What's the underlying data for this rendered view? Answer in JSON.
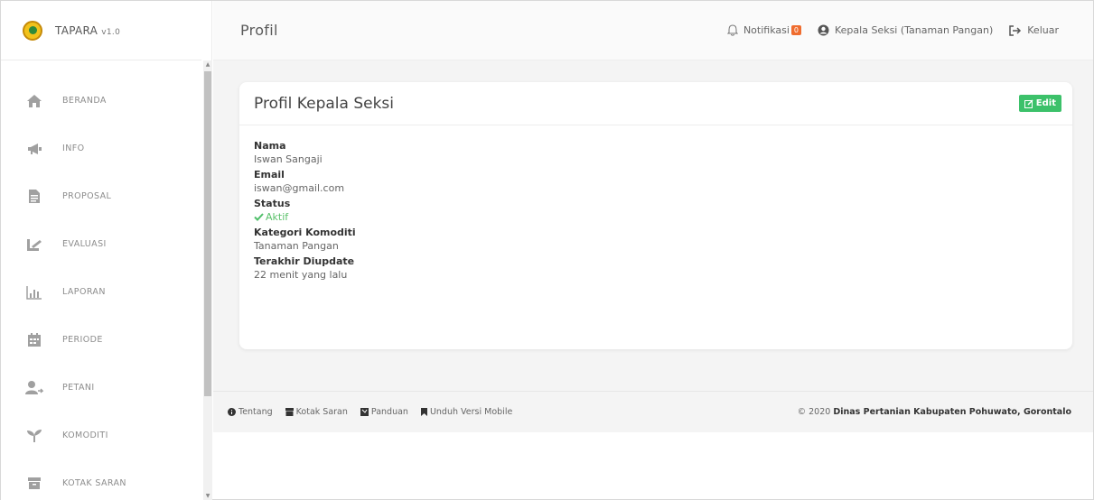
{
  "brand": {
    "name": "TAPARA",
    "version": "v1.0"
  },
  "sidebar": {
    "items": [
      {
        "label": "BERANDA",
        "icon": "home-icon"
      },
      {
        "label": "INFO",
        "icon": "megaphone-icon"
      },
      {
        "label": "PROPOSAL",
        "icon": "file-icon"
      },
      {
        "label": "EVALUASI",
        "icon": "evaluation-icon"
      },
      {
        "label": "LAPORAN",
        "icon": "bar-chart-icon"
      },
      {
        "label": "PERIODE",
        "icon": "calendar-icon"
      },
      {
        "label": "PETANI",
        "icon": "users-icon"
      },
      {
        "label": "KOMODITI",
        "icon": "sprout-icon"
      },
      {
        "label": "KOTAK SARAN",
        "icon": "inbox-icon"
      }
    ]
  },
  "header": {
    "title": "Profil",
    "notif_label": "Notifikasi",
    "notif_count": "0",
    "user_label": "Kepala Seksi (Tanaman Pangan)",
    "logout_label": "Keluar"
  },
  "profile": {
    "title": "Profil Kepala Seksi",
    "edit_label": "Edit",
    "fields": [
      {
        "label": "Nama",
        "value": "Iswan Sangaji"
      },
      {
        "label": "Email",
        "value": "iswan@gmail.com"
      },
      {
        "label": "Status",
        "value": "Aktif"
      },
      {
        "label": "Kategori Komoditi",
        "value": "Tanaman Pangan"
      },
      {
        "label": "Terakhir Diupdate",
        "value": "22 menit yang lalu"
      }
    ]
  },
  "footer": {
    "links": [
      "Tentang",
      "Kotak Saran",
      "Panduan",
      "Unduh Versi Mobile"
    ],
    "copyright_prefix": "© 2020",
    "copyright_org": "Dinas Pertanian Kabupaten Pohuwato, Gorontalo"
  },
  "colors": {
    "accent_green": "#3cc16a",
    "badge_orange": "#ef6c2e",
    "status_green": "#5ac16a"
  }
}
